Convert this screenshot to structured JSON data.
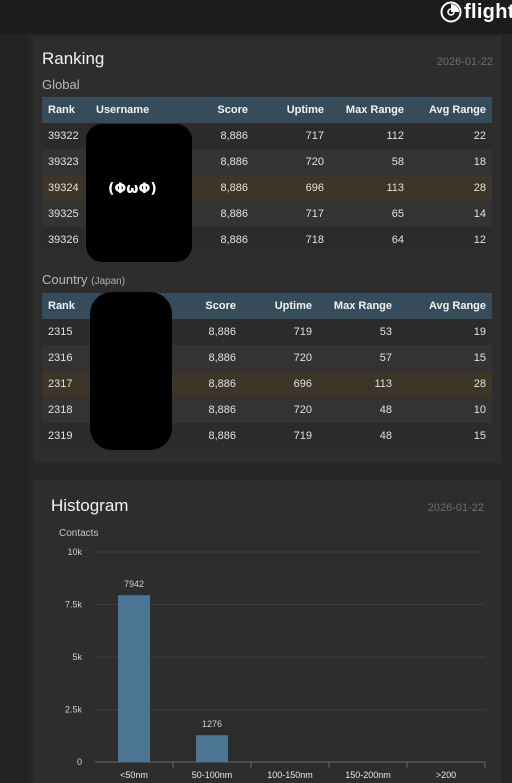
{
  "brand": {
    "name": "flight",
    "icon": "radar-logo-icon"
  },
  "ranking": {
    "title": "Ranking",
    "date": "2026-01-22",
    "global": {
      "label": "Global",
      "columns": [
        "Rank",
        "Username",
        "Score",
        "Uptime",
        "Max Range",
        "Avg Range"
      ],
      "rows": [
        {
          "rank": "39322",
          "score": "8,886",
          "uptime": "717",
          "max_range": "112",
          "avg_range": "22"
        },
        {
          "rank": "39323",
          "score": "8,886",
          "uptime": "720",
          "max_range": "58",
          "avg_range": "18"
        },
        {
          "rank": "39324",
          "score": "8,886",
          "uptime": "696",
          "max_range": "113",
          "avg_range": "28"
        },
        {
          "rank": "39325",
          "score": "8,886",
          "uptime": "717",
          "max_range": "65",
          "avg_range": "14"
        },
        {
          "rank": "39326",
          "score": "8,886",
          "uptime": "718",
          "max_range": "64",
          "avg_range": "12"
        }
      ],
      "highlight_row": 2,
      "redaction_text": "(ΦωΦ)"
    },
    "country": {
      "label": "Country",
      "country_name": "(Japan)",
      "columns": [
        "Rank",
        "Score",
        "Uptime",
        "Max Range",
        "Avg Range"
      ],
      "rows": [
        {
          "rank": "2315",
          "score": "8,886",
          "uptime": "719",
          "max_range": "53",
          "avg_range": "19"
        },
        {
          "rank": "2316",
          "score": "8,886",
          "uptime": "720",
          "max_range": "57",
          "avg_range": "15"
        },
        {
          "rank": "2317",
          "score": "8,886",
          "uptime": "696",
          "max_range": "113",
          "avg_range": "28"
        },
        {
          "rank": "2318",
          "score": "8,886",
          "uptime": "720",
          "max_range": "48",
          "avg_range": "10"
        },
        {
          "rank": "2319",
          "score": "8,886",
          "uptime": "719",
          "max_range": "48",
          "avg_range": "15"
        }
      ],
      "highlight_row": 2
    }
  },
  "histogram": {
    "title": "Histogram",
    "date": "2026-01-22"
  },
  "chart_data": {
    "type": "bar",
    "ylabel": "Contacts",
    "categories": [
      "<50nm",
      "50-100nm",
      "100-150nm",
      "150-200nm",
      ">200"
    ],
    "values": [
      7942,
      1276,
      0,
      0,
      0
    ],
    "data_labels": [
      "7942",
      "1276",
      null,
      null,
      null
    ],
    "ylim": [
      0,
      10000
    ],
    "yticks": [
      0,
      2500,
      5000,
      7500,
      10000
    ],
    "ytick_labels": [
      "0",
      "2.5k",
      "5k",
      "7.5k",
      "10k"
    ],
    "grid": true,
    "bar_color": "#4b7593"
  }
}
